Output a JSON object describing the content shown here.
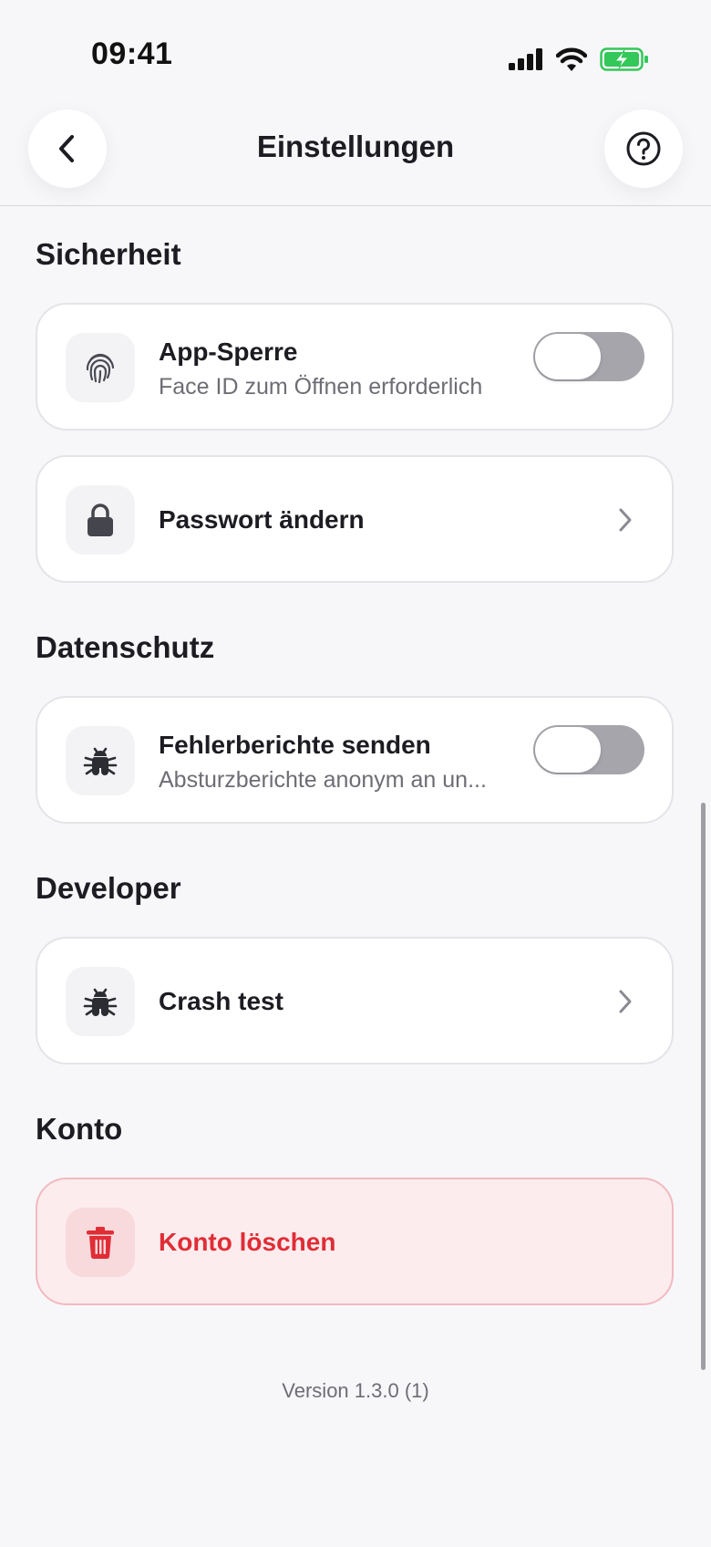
{
  "status_bar": {
    "time": "09:41",
    "icons": [
      "signal-icon",
      "wifi-icon",
      "battery-charging-icon"
    ],
    "battery_color": "#34c759"
  },
  "header": {
    "title": "Einstellungen",
    "back_icon": "chevron-left-icon",
    "help_icon": "help-icon"
  },
  "sections": {
    "security": {
      "title": "Sicherheit",
      "app_lock": {
        "title": "App-Sperre",
        "subtitle": "Face ID zum Öffnen erforderlich",
        "icon": "fingerprint-icon",
        "enabled": false
      },
      "change_password": {
        "title": "Passwort ändern",
        "icon": "lock-icon"
      }
    },
    "privacy": {
      "title": "Datenschutz",
      "crash_reports": {
        "title": "Fehlerberichte senden",
        "subtitle": "Absturzberichte anonym an un...",
        "icon": "bug-icon",
        "enabled": false
      }
    },
    "developer": {
      "title": "Developer",
      "crash_test": {
        "title": "Crash test",
        "icon": "bug-icon"
      }
    },
    "account": {
      "title": "Konto",
      "delete_account": {
        "title": "Konto löschen",
        "icon": "trash-icon",
        "color": "#e02d36"
      }
    }
  },
  "footer": {
    "version": "Version 1.3.0 (1)"
  }
}
